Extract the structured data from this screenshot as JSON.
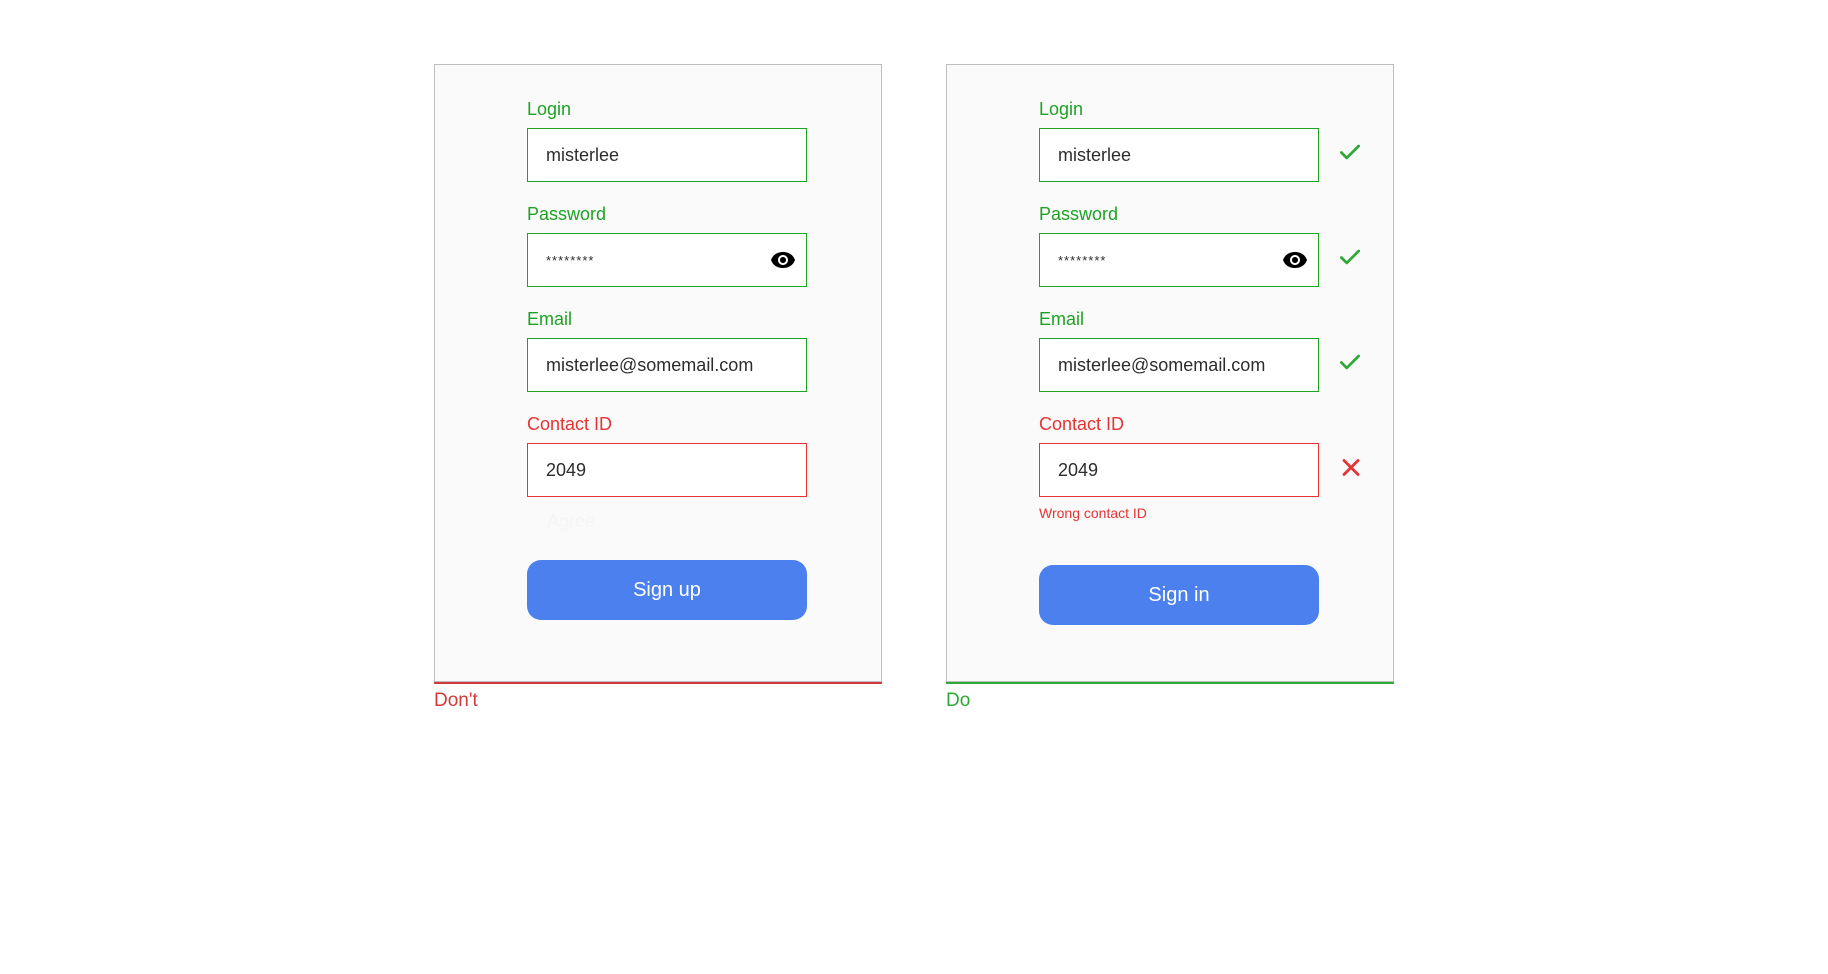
{
  "dont_panel": {
    "caption": "Don't",
    "fields": {
      "login": {
        "label": "Login",
        "value": "misterlee"
      },
      "password": {
        "label": "Password",
        "value": "********"
      },
      "email": {
        "label": "Email",
        "value": "misterlee@somemail.com"
      },
      "contact": {
        "label": "Contact ID",
        "value": "2049"
      }
    },
    "agree_label": "Agree",
    "button_label": "Sign up"
  },
  "do_panel": {
    "caption": "Do",
    "fields": {
      "login": {
        "label": "Login",
        "value": "misterlee"
      },
      "password": {
        "label": "Password",
        "value": "********"
      },
      "email": {
        "label": "Email",
        "value": "misterlee@somemail.com"
      },
      "contact": {
        "label": "Contact ID",
        "value": "2049",
        "error_msg": "Wrong contact ID"
      }
    },
    "button_label": "Sign in"
  }
}
